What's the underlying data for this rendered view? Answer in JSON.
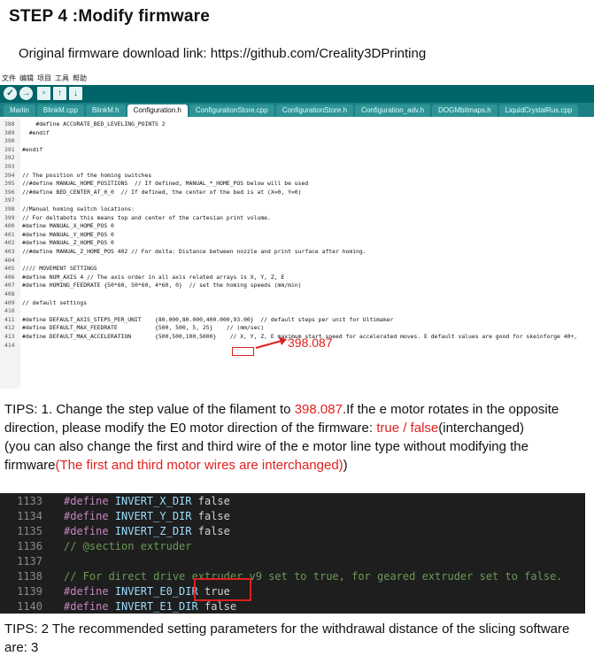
{
  "heading": {
    "title": "STEP 4 :Modify firmware"
  },
  "link_line": "Original firmware download link: https://github.com/Creality3DPrinting",
  "ide": {
    "menu": [
      "文件",
      "编辑",
      "项目",
      "工具",
      "帮助"
    ],
    "tabs": [
      "Marlin",
      "BlinkM.cpp",
      "BlinkM.h",
      "Configuration.h",
      "ConfigurationStore.cpp",
      "ConfigurationStore.h",
      "Configuration_adv.h",
      "DOGMbitmaps.h",
      "LiquidCrystalRus.cpp"
    ],
    "active_tab": "Configuration.h",
    "code_lines": [
      {
        "n": "388",
        "t": "    #define ACCURATE_BED_LEVELING_POINTS 2"
      },
      {
        "n": "389",
        "t": "  #endif"
      },
      {
        "n": "390",
        "t": ""
      },
      {
        "n": "391",
        "t": "#endif"
      },
      {
        "n": "392",
        "t": ""
      },
      {
        "n": "393",
        "t": ""
      },
      {
        "n": "394",
        "t": "// The position of the homing switches"
      },
      {
        "n": "395",
        "t": "//#define MANUAL_HOME_POSITIONS  // If defined, MANUAL_*_HOME_POS below will be used"
      },
      {
        "n": "396",
        "t": "//#define BED_CENTER_AT_0_0  // If defined, the center of the bed is at (X=0, Y=0)"
      },
      {
        "n": "397",
        "t": ""
      },
      {
        "n": "398",
        "t": "//Manual homing switch locations:"
      },
      {
        "n": "399",
        "t": "// For deltabots this means top and center of the cartesian print volume."
      },
      {
        "n": "400",
        "t": "#define MANUAL_X_HOME_POS 0"
      },
      {
        "n": "401",
        "t": "#define MANUAL_Y_HOME_POS 0"
      },
      {
        "n": "402",
        "t": "#define MANUAL_Z_HOME_POS 0"
      },
      {
        "n": "403",
        "t": "//#define MANUAL_Z_HOME_POS 402 // For delta: Distance between nozzle and print surface after homing."
      },
      {
        "n": "404",
        "t": ""
      },
      {
        "n": "405",
        "t": "//// MOVEMENT SETTINGS"
      },
      {
        "n": "406",
        "t": "#define NUM_AXIS 4 // The axis order in all axis related arrays is X, Y, Z, E"
      },
      {
        "n": "407",
        "t": "#define HOMING_FEEDRATE {50*60, 50*60, 4*60, 0}  // set the homing speeds (mm/min)"
      },
      {
        "n": "408",
        "t": ""
      },
      {
        "n": "409",
        "t": "// default settings"
      },
      {
        "n": "410",
        "t": ""
      },
      {
        "n": "411",
        "t": "#define DEFAULT_AXIS_STEPS_PER_UNIT    {80.000,80.000,400.000,93.00}  // default steps per unit for Ultimaker"
      },
      {
        "n": "412",
        "t": "#define DEFAULT_MAX_FEEDRATE           {500, 500, 5, 25}    // (mm/sec)"
      },
      {
        "n": "413",
        "t": "#define DEFAULT_MAX_ACCELERATION       {500,500,100,5000}    // X, Y, Z, E maximum start speed for accelerated moves. E default values are good for skeinforge 40+,"
      },
      {
        "n": "414",
        "t": ""
      }
    ],
    "annotation_value": "398.087"
  },
  "tips1": {
    "p1": "TIPS: 1. Change the step value of the filament to ",
    "p1_red": "398.087",
    "p2": ".If the e motor rotates in the opposite direction, please modify the E0 motor direction of the firmware: ",
    "p2_red": "true / false",
    "p3": "(interchanged)",
    "p4": " (you can also change the first and third wire of the e motor line type without modifying the firmware",
    "p4_red": "(The first and third motor wires are interchanged)",
    "p5": ")"
  },
  "dark_code": [
    {
      "n": "1133",
      "kw": "#define",
      "id": "INVERT_X_DIR",
      "val": "false",
      "cm": ""
    },
    {
      "n": "1134",
      "kw": "#define",
      "id": "INVERT_Y_DIR",
      "val": "false",
      "cm": ""
    },
    {
      "n": "1135",
      "kw": "#define",
      "id": "INVERT_Z_DIR",
      "val": "false",
      "cm": ""
    },
    {
      "n": "1136",
      "kw": "",
      "id": "",
      "val": "",
      "cm": "// @section extruder"
    },
    {
      "n": "1137",
      "kw": "",
      "id": "",
      "val": "",
      "cm": ""
    },
    {
      "n": "1138",
      "kw": "",
      "id": "",
      "val": "",
      "cm": "// For direct drive extruder v9 set to true, for geared extruder set to false."
    },
    {
      "n": "1139",
      "kw": "#define",
      "id": "INVERT_E0_DIR",
      "val": "true",
      "cm": ""
    },
    {
      "n": "1140",
      "kw": "#define",
      "id": "INVERT_E1_DIR",
      "val": "false",
      "cm": ""
    }
  ],
  "tips2": "TIPS: 2 The recommended setting parameters for the withdrawal distance of the slicing software are: 3",
  "colors": {
    "accent_red": "#e02020",
    "ide_toolbar": "#006468",
    "ide_tabs": "#1b7f84",
    "dark_bg": "#1e1e1e"
  }
}
